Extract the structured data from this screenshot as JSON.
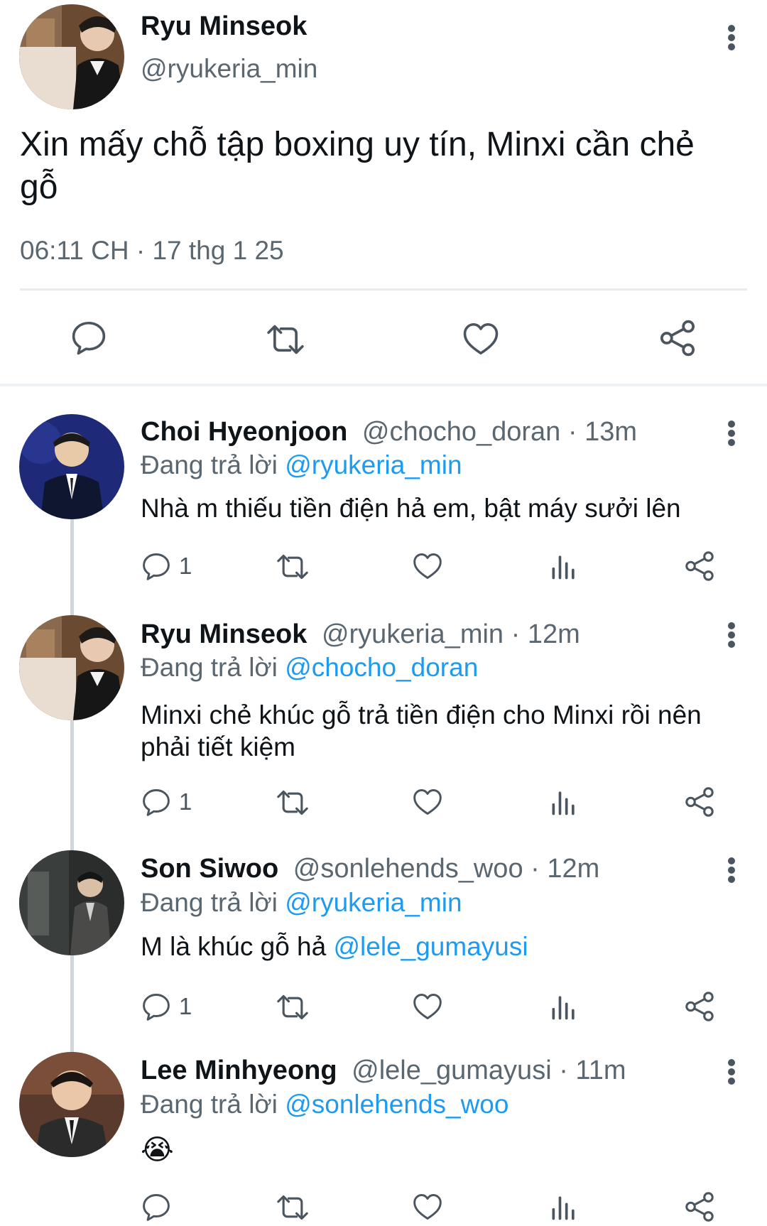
{
  "main_tweet": {
    "author_name": "Ryu Minseok",
    "handle": "@ryukeria_min",
    "text": "Xin mấy chỗ tập boxing uy tín, Minxi cần chẻ gỗ",
    "timestamp": "06:11 CH · 17 thg 1 25"
  },
  "reply_prefix": "Đang trả lời",
  "replies": [
    {
      "name": "Choi Hyeonjoon",
      "handle": "@chocho_doran",
      "time": "· 13m",
      "replying_to": "@ryukeria_min",
      "text": "Nhà m thiếu tiền điện hả em, bật máy sưởi lên",
      "reply_count": "1"
    },
    {
      "name": "Ryu Minseok",
      "handle": "@ryukeria_min",
      "time": "· 12m",
      "replying_to": "@chocho_doran",
      "text": "Minxi chẻ khúc gỗ trả tiền điện cho Minxi rồi nên phải tiết kiệm",
      "reply_count": "1"
    },
    {
      "name": "Son Siwoo",
      "handle": "@sonlehends_woo",
      "time": "· 12m",
      "replying_to": "@ryukeria_min",
      "text": "M là khúc gỗ hả",
      "mention": "@lele_gumayusi",
      "reply_count": "1"
    },
    {
      "name": "Lee Minhyeong",
      "handle": "@lele_gumayusi",
      "time": "· 11m",
      "replying_to": "@sonlehends_woo",
      "text": "😭",
      "reply_count": ""
    }
  ],
  "icons": {
    "reply": "reply-icon",
    "retweet": "retweet-icon",
    "like": "heart-icon",
    "views": "views-icon",
    "share": "share-icon",
    "more": "more-vertical-icon"
  },
  "colors": {
    "link": "#1d9bf0",
    "text": "#0f1419",
    "secondary": "#5b6770",
    "divider": "#e7ebee"
  }
}
